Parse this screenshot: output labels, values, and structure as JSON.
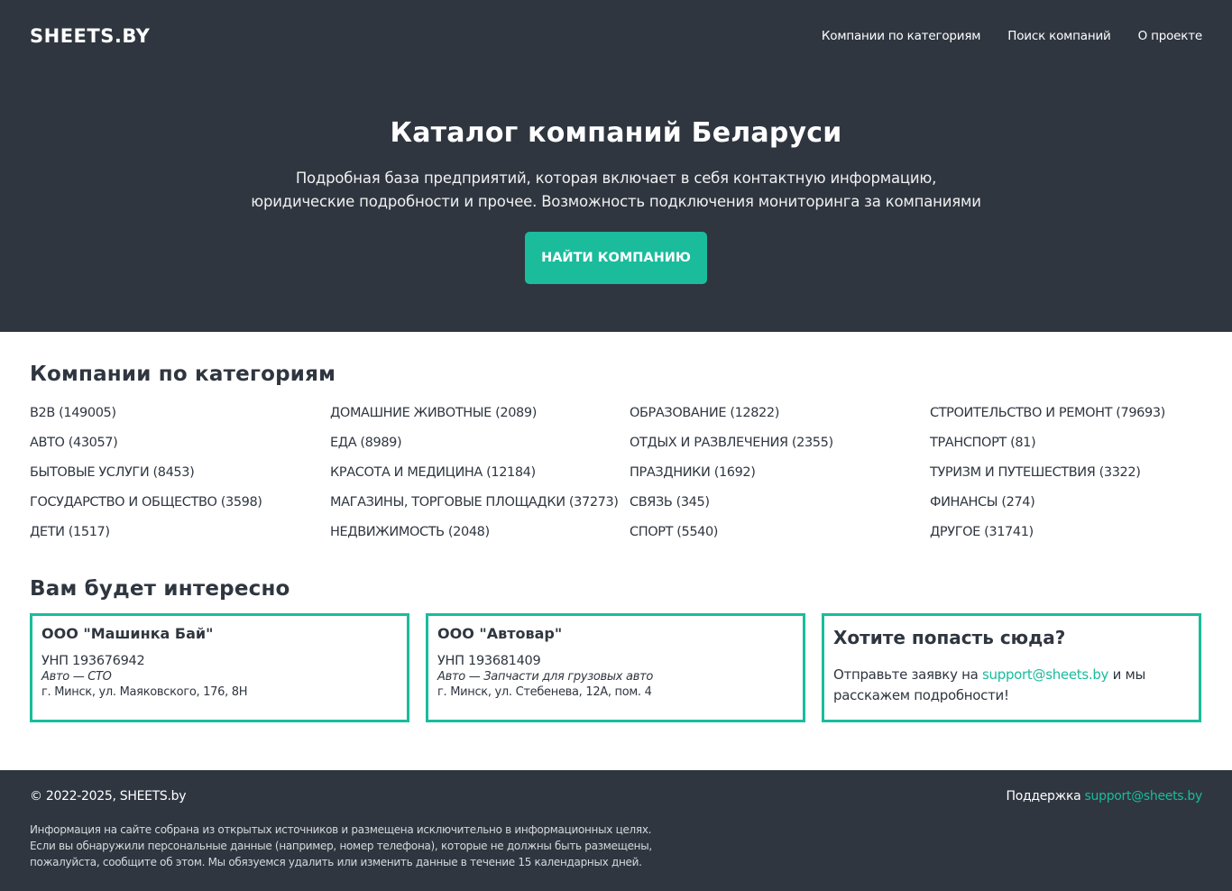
{
  "header": {
    "logo": "SHEETS.BY",
    "nav": [
      "Компании по категориям",
      "Поиск компаний",
      "О проекте"
    ]
  },
  "hero": {
    "title": "Каталог компаний Беларуси",
    "subtitle_line1": "Подробная база предприятий, которая включает в себя контактную информацию,",
    "subtitle_line2": "юридические подробности и прочее. Возможность подключения мониторинга за компаниями",
    "button": "НАЙТИ КОМПАНИЮ"
  },
  "categories": {
    "title": "Компании по категориям",
    "columns": [
      [
        "B2B (149005)",
        "АВТО (43057)",
        "БЫТОВЫЕ УСЛУГИ (8453)",
        "ГОСУДАРСТВО И ОБЩЕСТВО (3598)",
        "ДЕТИ (1517)"
      ],
      [
        "ДОМАШНИЕ ЖИВОТНЫЕ (2089)",
        "ЕДА (8989)",
        "КРАСОТА И МЕДИЦИНА (12184)",
        "МАГАЗИНЫ, ТОРГОВЫЕ ПЛОЩАДКИ (37273)",
        "НЕДВИЖИМОСТЬ (2048)"
      ],
      [
        "ОБРАЗОВАНИЕ (12822)",
        "ОТДЫХ И РАЗВЛЕЧЕНИЯ (2355)",
        "ПРАЗДНИКИ (1692)",
        "СВЯЗЬ (345)",
        "СПОРТ (5540)"
      ],
      [
        "СТРОИТЕЛЬСТВО И РЕМОНТ (79693)",
        "ТРАНСПОРТ (81)",
        "ТУРИЗМ И ПУТЕШЕСТВИЯ (3322)",
        "ФИНАНСЫ (274)",
        "ДРУГОЕ (31741)"
      ]
    ]
  },
  "interest": {
    "title": "Вам будет интересно",
    "cards": [
      {
        "name": "ООО \"Машинка Бай\"",
        "unp": "УНП 193676942",
        "category": "Авто — СТО",
        "address": "г. Минск, ул. Маяковского, 176, 8Н"
      },
      {
        "name": "ООО \"Автовар\"",
        "unp": "УНП 193681409",
        "category": "Авто — Запчасти для грузовых авто",
        "address": "г. Минск, ул. Стебенева, 12А, пом. 4"
      }
    ],
    "promo": {
      "title": "Хотите попасть сюда?",
      "text_before": "Отправьте заявку на",
      "email": "support@sheets.by",
      "text_after_1": "и мы",
      "text_after_2": "расскажем подробности!"
    }
  },
  "footer": {
    "copyright": "© 2022-2025, SHEETS.by",
    "support_label": "Поддержка",
    "support_email": "support@sheets.by",
    "note_line1": "Информация на сайте собрана из открытых источников и размещена исключительно в информационных целях.",
    "note_line2": "Если вы обнаружили персональные данные (например, номер телефона), которые не должны быть размещены,",
    "note_line3": "пожалуйста, сообщите об этом. Мы обязуемся удалить или изменить данные в течение 15 календарных дней."
  },
  "colors": {
    "dark": "#2f3640",
    "accent": "#1abc9c"
  }
}
